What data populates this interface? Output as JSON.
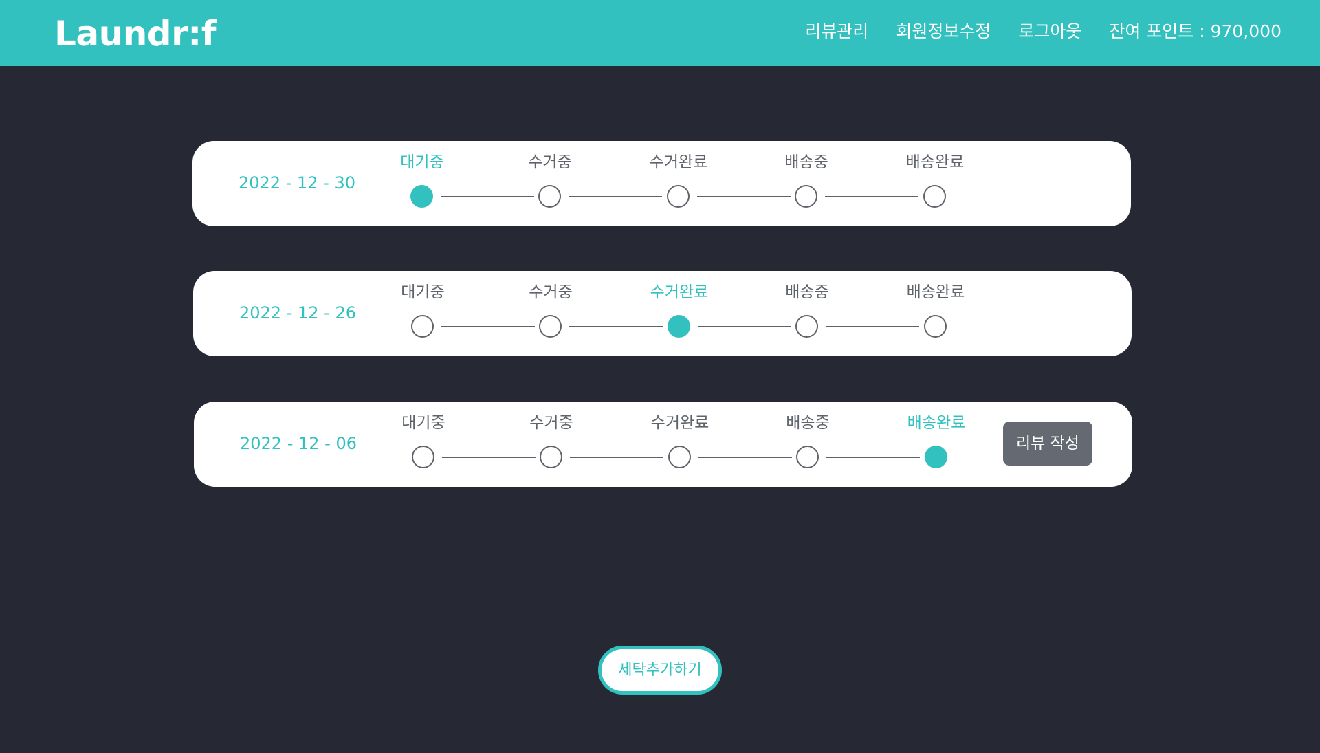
{
  "header": {
    "logo": "Laundr:f",
    "nav": {
      "review_manage": "리뷰관리",
      "edit_profile": "회원정보수정",
      "logout": "로그아웃"
    },
    "points": "잔여 포인트 : 970,000"
  },
  "colors": {
    "accent": "#33c1bf",
    "background": "#262933",
    "inactive": "#5f646b",
    "review_button": "#656a72"
  },
  "steps": [
    "대기중",
    "수거중",
    "수거완료",
    "배송중",
    "배송완료"
  ],
  "orders": [
    {
      "date": "2022 - 12 - 30",
      "current_step": 0,
      "review_button": null
    },
    {
      "date": "2022 - 12 - 26",
      "current_step": 2,
      "review_button": null
    },
    {
      "date": "2022 - 12 - 06",
      "current_step": 4,
      "review_button": "리뷰 작성"
    }
  ],
  "add_laundry_label": "세탁추가하기"
}
